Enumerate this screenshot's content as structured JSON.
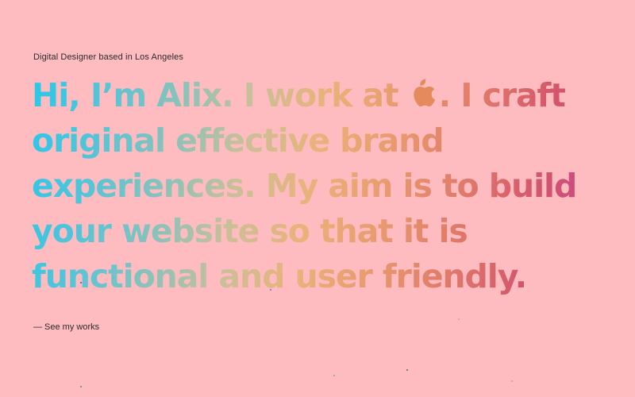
{
  "intro": {
    "subtitle": "Digital Designer based in Los Angeles"
  },
  "hero": {
    "line1_before": "Hi, I’m Alix. I work at ",
    "company_icon": "apple-logo-icon",
    "line1_after": ". I craft",
    "line2": "original effective brand",
    "line3": "experiences. My aim is to build",
    "line4": "your website so that it is",
    "line5": "functional and user friendly."
  },
  "cta": {
    "works_link": "— See my works"
  },
  "colors": {
    "background": "#ffbcc0",
    "gradient_start": "#28c8e8",
    "gradient_end": "#c43a9a",
    "apple_logo": "#e58a5c"
  }
}
